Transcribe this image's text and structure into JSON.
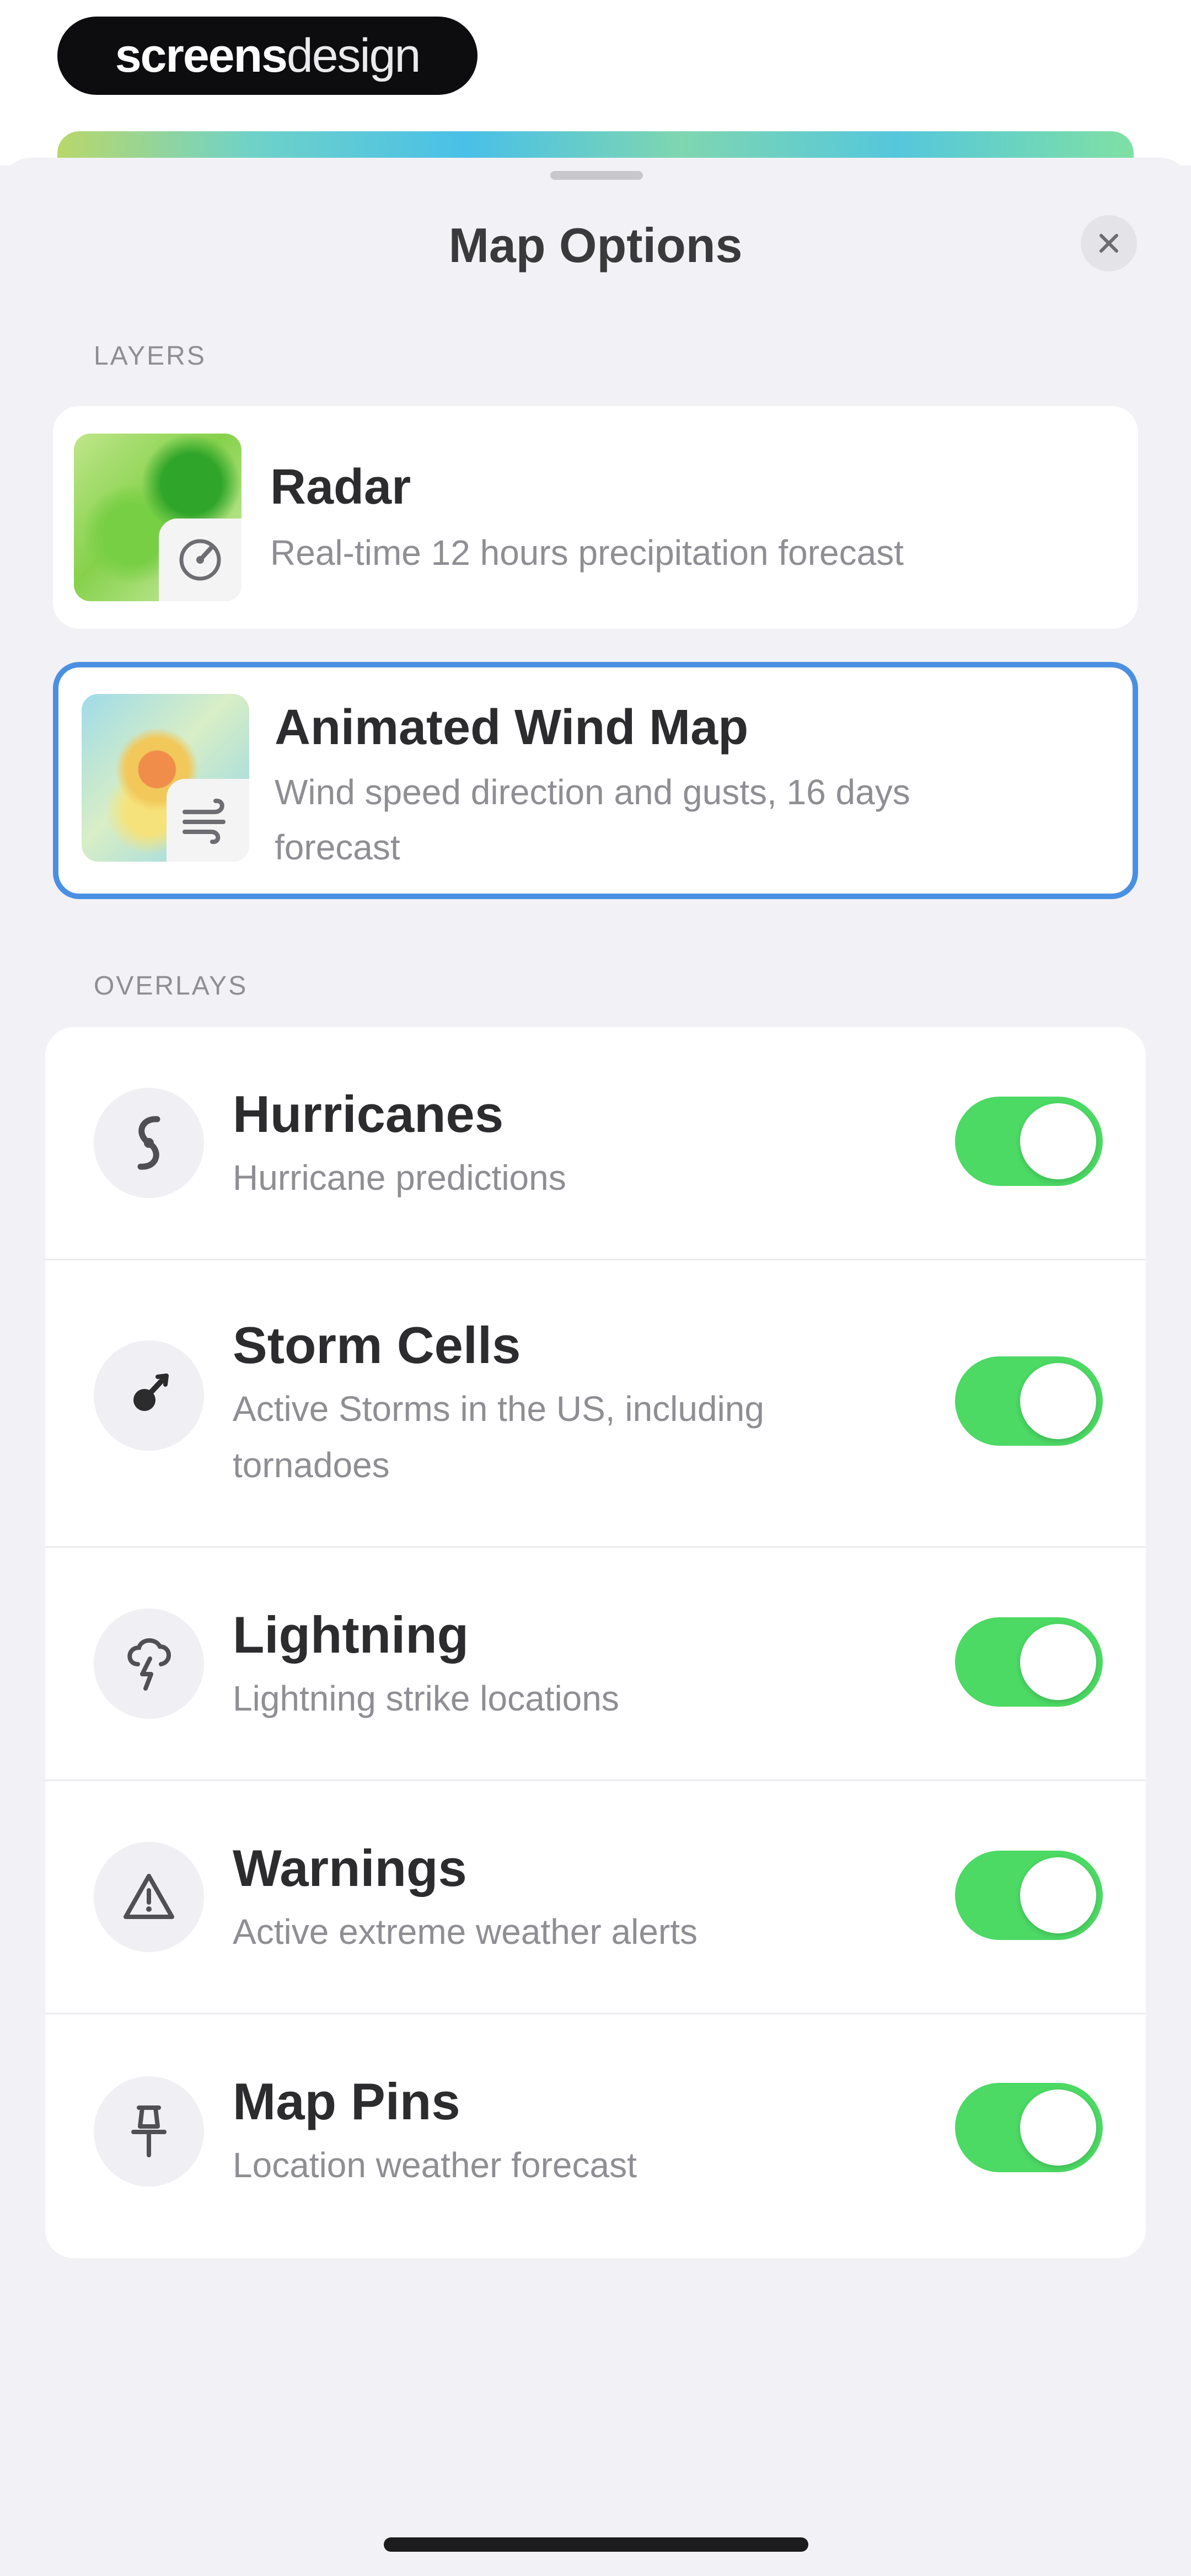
{
  "brand": {
    "bold_part": "screens",
    "light_part": "design"
  },
  "sheet": {
    "title": "Map Options",
    "close_icon": "close-icon"
  },
  "layers": {
    "section_label": "LAYERS",
    "items": [
      {
        "title": "Radar",
        "subtitle": "Real-time 12 hours precipitation forecast",
        "icon": "radar-icon",
        "selected": false
      },
      {
        "title": "Animated Wind Map",
        "subtitle": "Wind speed direction and gusts, 16 days forecast",
        "icon": "wind-icon",
        "selected": true
      }
    ]
  },
  "overlays": {
    "section_label": "OVERLAYS",
    "items": [
      {
        "title": "Hurricanes",
        "subtitle": "Hurricane predictions",
        "icon": "hurricane-icon",
        "enabled": true
      },
      {
        "title": "Storm Cells",
        "subtitle": "Active Storms in the US, including tornadoes",
        "icon": "storm-cell-icon",
        "enabled": true
      },
      {
        "title": "Lightning",
        "subtitle": "Lightning strike locations",
        "icon": "lightning-icon",
        "enabled": true
      },
      {
        "title": "Warnings",
        "subtitle": "Active extreme weather alerts",
        "icon": "warning-icon",
        "enabled": true
      },
      {
        "title": "Map Pins",
        "subtitle": "Location weather forecast",
        "icon": "map-pin-icon",
        "enabled": true
      }
    ]
  },
  "colors": {
    "toggle_on": "#4cd964",
    "selected_border": "#4a90e2",
    "sheet_background": "#f1f1f6"
  }
}
